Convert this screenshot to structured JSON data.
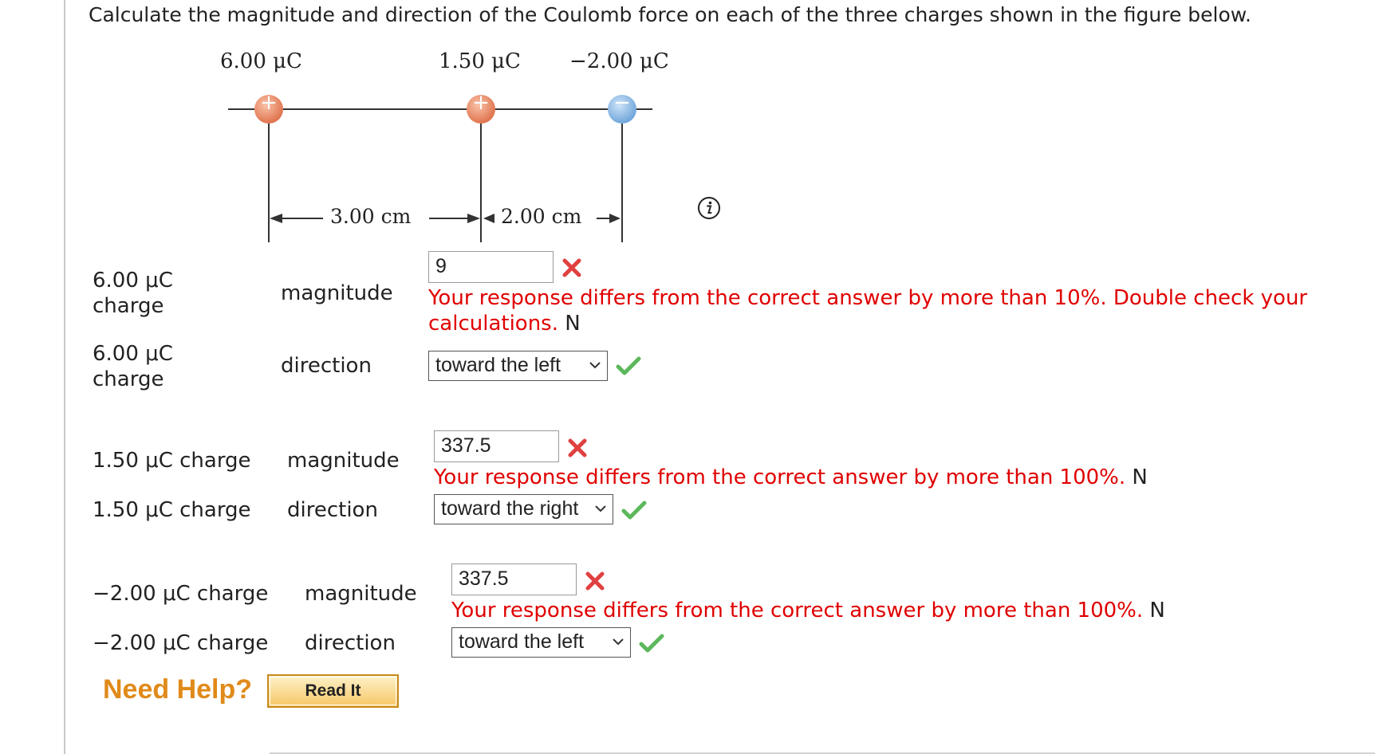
{
  "question": "Calculate the magnitude and direction of the Coulomb force on each of the three charges shown in the figure below.",
  "figure": {
    "charge_labels": [
      "6.00 μC",
      "1.50 μC",
      "−2.00 μC"
    ],
    "distance_1": "3.00 cm",
    "distance_2": "2.00 cm",
    "plus_sign": "+",
    "minus_sign": "−"
  },
  "rows": [
    {
      "charge_label_line1": "6.00 μC",
      "charge_label_line2": "charge",
      "magnitude_label": "magnitude",
      "magnitude_value": "9",
      "feedback": "Your response differs from the correct answer by more than 10%. Double check your",
      "feedback_line2": "calculations.",
      "feedback_suffix": "N",
      "direction_charge_line1": "6.00 μC",
      "direction_charge_line2": "charge",
      "direction_label": "direction",
      "direction_value": "toward the left"
    },
    {
      "charge_label": "1.50 μC charge",
      "magnitude_label": "magnitude",
      "magnitude_value": "337.5",
      "feedback": "Your response differs from the correct answer by more than 100%.",
      "feedback_suffix": "N",
      "direction_charge": "1.50 μC charge",
      "direction_label": "direction",
      "direction_value": "toward the right"
    },
    {
      "charge_label": "−2.00 μC charge",
      "magnitude_label": "magnitude",
      "magnitude_value": "337.5",
      "feedback": "Your response differs from the correct answer by more than 100%.",
      "feedback_suffix": "N",
      "direction_charge": "−2.00 μC charge",
      "direction_label": "direction",
      "direction_value": "toward the left"
    }
  ],
  "help": {
    "title": "Need Help?",
    "read_it": "Read It"
  },
  "colors": {
    "error_red": "#e00000",
    "check_green": "#5cb85c",
    "help_orange": "#e08a1a"
  }
}
